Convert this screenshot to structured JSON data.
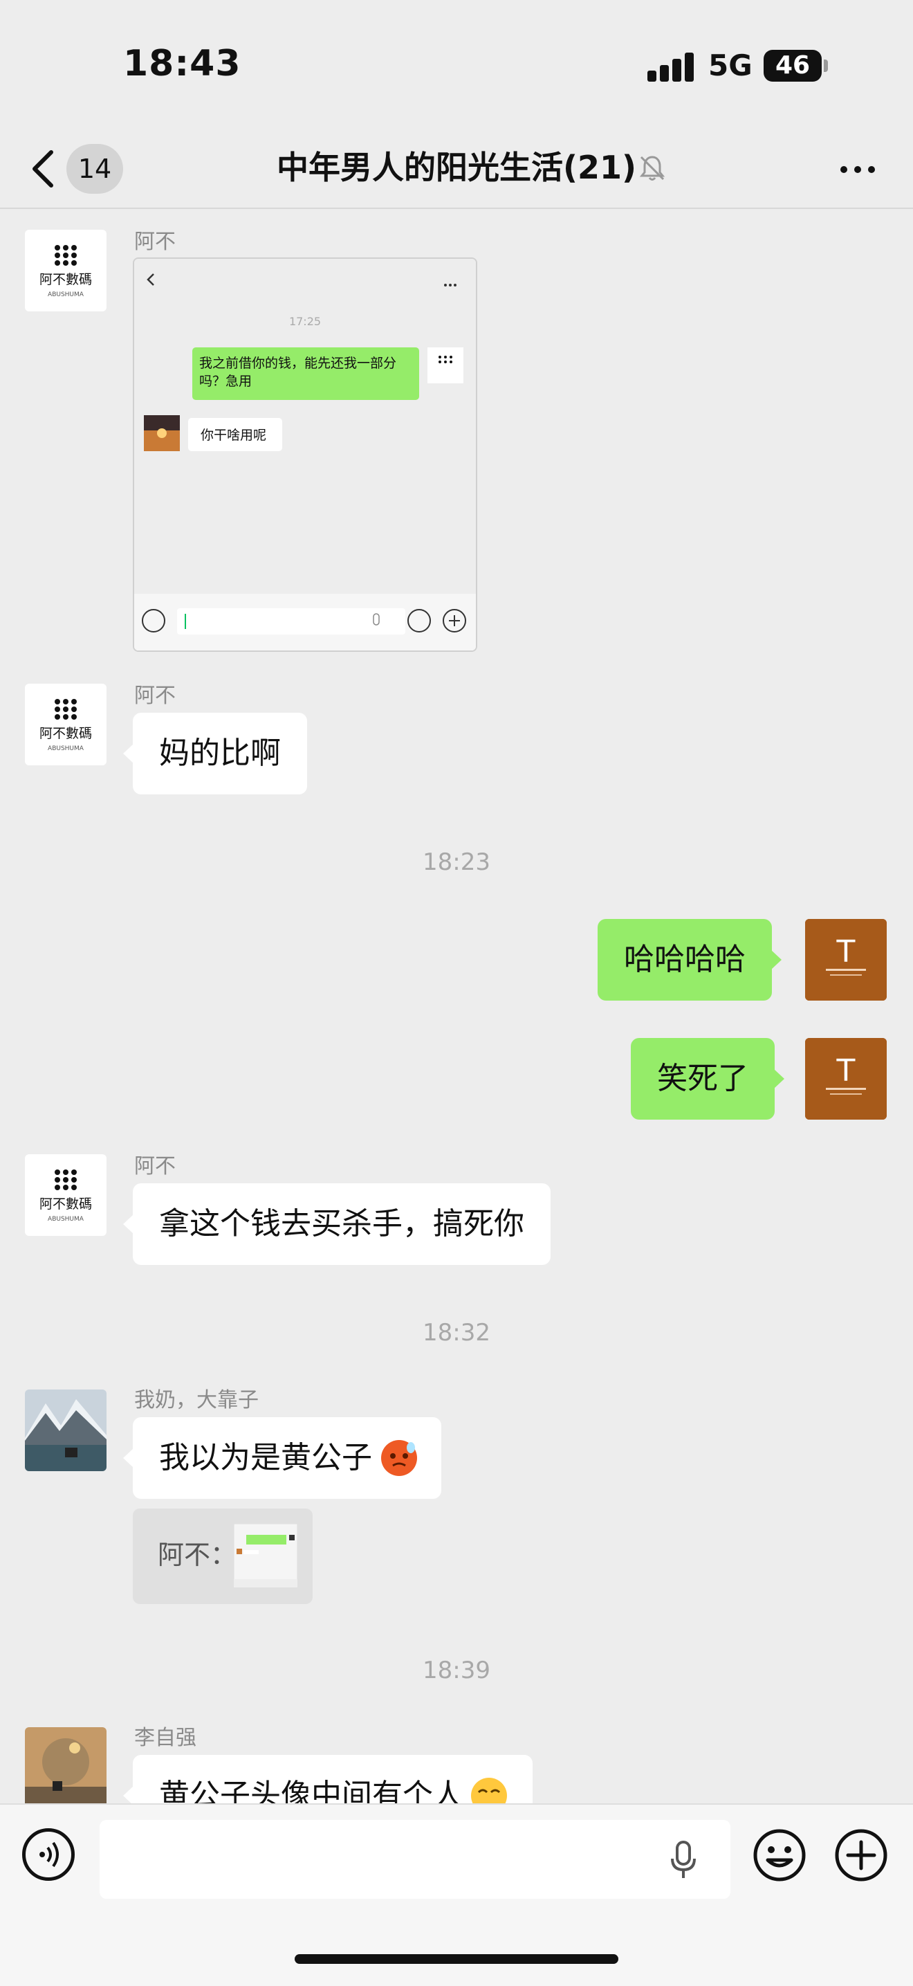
{
  "status_bar": {
    "time": "18:43",
    "network": "5G",
    "battery": "46"
  },
  "nav": {
    "back_count": "14",
    "title": "中年男人的阳光生活(21)"
  },
  "messages": {
    "m1": {
      "sender": "阿不"
    },
    "shot": {
      "time": "17:25",
      "own_text": "我之前借你的钱，能先还我一部分吗？急用",
      "reply_text": "你干啥用呢"
    },
    "m2": {
      "sender": "阿不",
      "text": "妈的比啊"
    },
    "ts1": "18:23",
    "m3": {
      "text": "哈哈哈哈"
    },
    "m4": {
      "text": "笑死了"
    },
    "m5": {
      "sender": "阿不",
      "text": "拿这个钱去买杀手，搞死你"
    },
    "ts2": "18:32",
    "m6": {
      "sender": "我奶，大靠子",
      "text": "我以为是黄公子",
      "quote_prefix": "阿不："
    },
    "ts3": "18:39",
    "m7": {
      "sender": "李自强",
      "text": "黄公子头像中间有个人"
    }
  },
  "avatars": {
    "abu": {
      "cn": "阿不數碼",
      "en": "ABUSHUMA"
    },
    "self": {
      "letter": "T"
    }
  },
  "colors": {
    "background": "#ededed",
    "bubble_self": "#95ec69",
    "bubble_other": "#ffffff",
    "avatar_self": "#a75a1a"
  }
}
